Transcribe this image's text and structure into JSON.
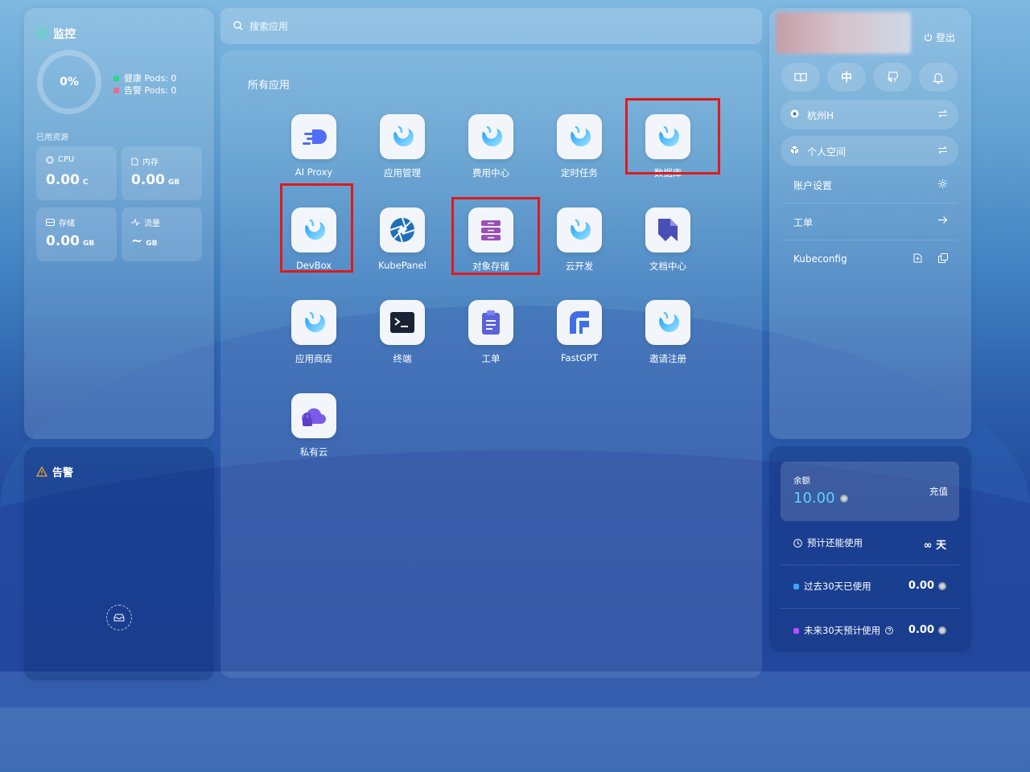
{
  "monitor": {
    "title": "监控",
    "percent": "0%",
    "healthy": "健康 Pods: 0",
    "alert_pods": "告警 Pods: 0",
    "used_label": "已用资源",
    "cards": [
      {
        "label": "CPU",
        "value": "0.00",
        "unit": "C"
      },
      {
        "label": "内存",
        "value": "0.00",
        "unit": "GB"
      },
      {
        "label": "存储",
        "value": "0.00",
        "unit": "GB"
      },
      {
        "label": "流量",
        "value": "~",
        "unit": "GB"
      }
    ]
  },
  "alerts": {
    "title": "告警"
  },
  "search": {
    "placeholder": "搜索应用"
  },
  "apps": {
    "title": "所有应用",
    "items": [
      {
        "name": "AI Proxy",
        "icon": "ai-proxy-icon"
      },
      {
        "name": "应用管理",
        "icon": "sealos-icon"
      },
      {
        "name": "费用中心",
        "icon": "sealos-icon"
      },
      {
        "name": "定时任务",
        "icon": "sealos-icon"
      },
      {
        "name": "数据库",
        "icon": "sealos-icon"
      },
      {
        "name": "DevBox",
        "icon": "sealos-icon"
      },
      {
        "name": "KubePanel",
        "icon": "aperture-icon"
      },
      {
        "name": "对象存储",
        "icon": "drawer-icon"
      },
      {
        "name": "云开发",
        "icon": "sealos-icon"
      },
      {
        "name": "文档中心",
        "icon": "bookmark-icon"
      },
      {
        "name": "应用商店",
        "icon": "sealos-icon"
      },
      {
        "name": "终端",
        "icon": "terminal-icon"
      },
      {
        "name": "工单",
        "icon": "clipboard-icon"
      },
      {
        "name": "FastGPT",
        "icon": "fastgpt-icon"
      },
      {
        "name": "邀请注册",
        "icon": "sealos-icon"
      },
      {
        "name": "私有云",
        "icon": "cloud-lock-icon"
      }
    ]
  },
  "user": {
    "logout": "登出",
    "lang": "中",
    "region": "杭州H",
    "workspace": "个人空间",
    "account": "账户设置",
    "ticket": "工单",
    "kubeconfig": "Kubeconfig"
  },
  "finance": {
    "balance_label": "余额",
    "balance": "10.00",
    "recharge": "充值",
    "usable_label": "预计还能使用",
    "usable_value": "∞ 天",
    "past_label": "过去30天已使用",
    "past_value": "0.00",
    "future_label": "未来30天预计使用",
    "future_value": "0.00"
  },
  "colors": {
    "healthy": "#2fd38a",
    "alert": "#f06b85",
    "highlight": "#e01a1a",
    "balance": "#5fd3ff"
  }
}
